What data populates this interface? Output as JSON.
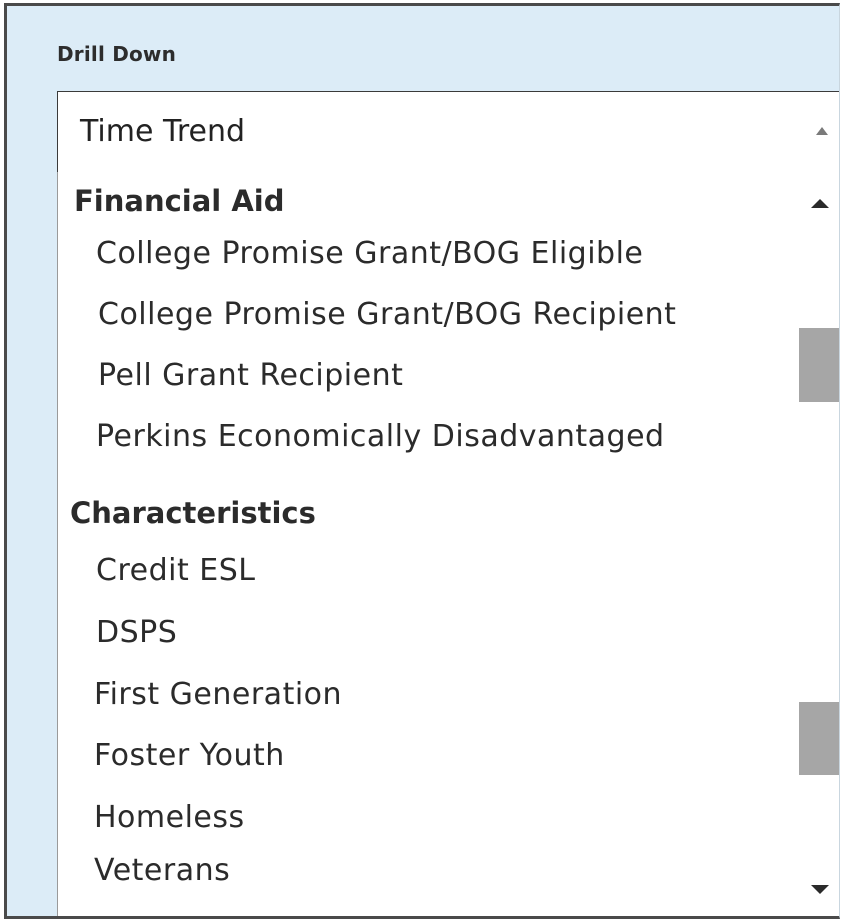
{
  "panel": {
    "title": "Drill Down"
  },
  "select": {
    "value": "Time Trend"
  },
  "dropdown": {
    "groups": [
      {
        "label": "Financial Aid",
        "options": [
          "College Promise Grant/BOG Eligible",
          "College Promise Grant/BOG Recipient",
          "Pell Grant Recipient",
          "Perkins Economically Disadvantaged"
        ]
      },
      {
        "label": "Characteristics",
        "options": [
          "Credit ESL",
          "DSPS",
          "First Generation",
          "Foster Youth",
          "Homeless",
          "Veterans"
        ]
      }
    ]
  },
  "icons": {
    "select_arrow": "caret-up-icon",
    "scroll_up": "scroll-up-arrow-icon",
    "scroll_down": "scroll-down-arrow-icon"
  },
  "colors": {
    "panel_background": "#dcecf7",
    "scroll_thumb": "#a6a6a6"
  }
}
